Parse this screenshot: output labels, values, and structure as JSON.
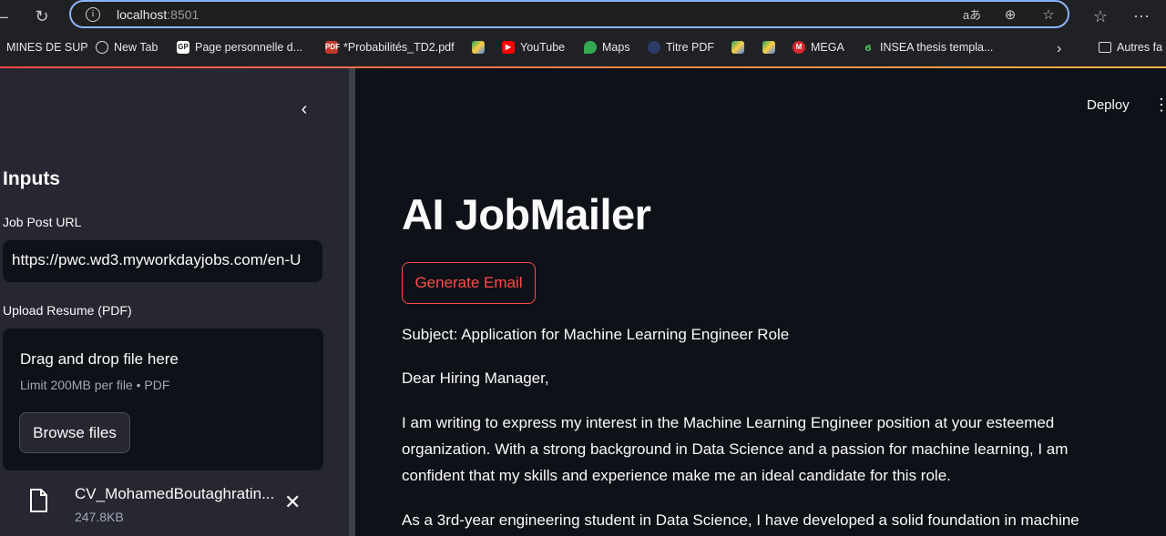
{
  "browser": {
    "url_host": "localhost",
    "url_port": ":8501",
    "bookmarks": [
      "MINES DE SUP",
      "New Tab",
      "Page personnelle d...",
      "*Probabilités_TD2.pdf",
      "YouTube",
      "Maps",
      "Titre PDF",
      "MEGA",
      "INSEA thesis templa...",
      "Autres fa"
    ]
  },
  "sidebar": {
    "heading": "Inputs",
    "job_url_label": "Job Post URL",
    "job_url_value": "https://pwc.wd3.myworkdayjobs.com/en-U",
    "upload_label": "Upload Resume (PDF)",
    "dropzone_title": "Drag and drop file here",
    "dropzone_limit": "Limit 200MB per file • PDF",
    "browse_label": "Browse files",
    "file_name": "CV_MohamedBoutaghratin...",
    "file_size": "247.8KB"
  },
  "header": {
    "deploy_label": "Deploy"
  },
  "main": {
    "title": "AI JobMailer",
    "generate_label": "Generate Email",
    "email_lines": [
      "Subject: Application for Machine Learning Engineer Role",
      "Dear Hiring Manager,",
      "I am writing to express my interest in the Machine Learning Engineer position at your esteemed organization. With a strong background in Data Science and a passion for machine learning, I am confident that my skills and experience make me an ideal candidate for this role.",
      "As a 3rd-year engineering student in Data Science, I have developed a solid foundation in machine"
    ]
  },
  "colors": {
    "accent": "#ff4b4b",
    "bg": "#0e1117",
    "sidebar": "#262730"
  }
}
